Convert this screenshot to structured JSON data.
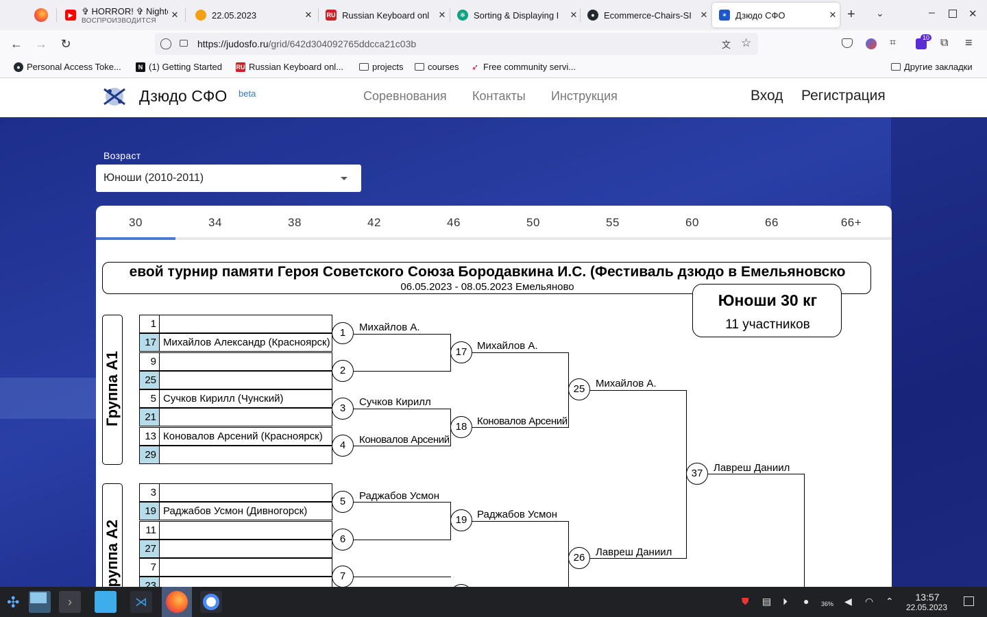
{
  "browser": {
    "tabs": [
      {
        "title": "✞ HORROR! ✞ Nightc",
        "subtitle": "ВОСПРОИЗВОДИТСЯ",
        "icon": "youtube-icon",
        "color": "#ff0000"
      },
      {
        "title": "22.05.2023",
        "icon": "loop-icon",
        "color": "#f4a015"
      },
      {
        "title": "Russian Keyboard onl",
        "icon": "ru-icon",
        "color": "#d01f25"
      },
      {
        "title": "Sorting & Displaying I",
        "icon": "openai-icon",
        "color": "#10a37f"
      },
      {
        "title": "Ecommerce-Chairs-SI",
        "icon": "github-icon",
        "color": "#24292f"
      },
      {
        "title": "Дзюдо СФО",
        "icon": "judo-icon",
        "color": "#1e57c8",
        "active": true
      }
    ],
    "url_host": "https://judosfo.ru",
    "url_path": "/grid/642d304092765ddcca21c03b",
    "extension_badge": "10",
    "bookmarks": [
      "Personal Access Toke...",
      "(1) Getting Started",
      "Russian Keyboard onl...",
      "projects",
      "courses",
      "Free community servi..."
    ],
    "other_bookmarks": "Другие закладки"
  },
  "site": {
    "brand": "Дзюдо СФО",
    "brand_tag": "beta",
    "menu": [
      "Соревнования",
      "Контакты",
      "Инструкция"
    ],
    "login": "Вход",
    "register": "Регистрация",
    "age_label": "Возраст",
    "age_value": "Юноши (2010-2011)",
    "weights": [
      "30",
      "34",
      "38",
      "42",
      "46",
      "50",
      "55",
      "60",
      "66",
      "66+"
    ],
    "active_weight": "30"
  },
  "bracket": {
    "title": "евой турнир памяти Героя Советского Союза Бородавкина И.С. (Фестиваль дзюдо в Емельяновско",
    "subtitle": "06.05.2023 - 08.05.2023 Емельяново",
    "category": "Юноши 30 кг",
    "participants": "11 участников",
    "group_a1": "Группа А1",
    "group_a2": "Группа А2",
    "slots": [
      {
        "n": "1",
        "name": ""
      },
      {
        "n": "17",
        "name": "Михайлов Александр (Красноярск)"
      },
      {
        "n": "9",
        "name": ""
      },
      {
        "n": "25",
        "name": ""
      },
      {
        "n": "5",
        "name": "Сучков Кирилл (Чунский)"
      },
      {
        "n": "21",
        "name": ""
      },
      {
        "n": "13",
        "name": "Коновалов Арсений (Красноярск)"
      },
      {
        "n": "29",
        "name": ""
      },
      {
        "n": "3",
        "name": ""
      },
      {
        "n": "19",
        "name": "Раджабов Усмон (Дивногорск)"
      },
      {
        "n": "11",
        "name": ""
      },
      {
        "n": "27",
        "name": ""
      },
      {
        "n": "7",
        "name": ""
      },
      {
        "n": "23",
        "name": ""
      }
    ],
    "bouts": [
      {
        "n": "1",
        "winner": "Михайлов А."
      },
      {
        "n": "2",
        "winner": ""
      },
      {
        "n": "3",
        "winner": "Сучков Кирилл"
      },
      {
        "n": "4",
        "winner": "Коновалов Арсений"
      },
      {
        "n": "17",
        "winner": "Михайлов А."
      },
      {
        "n": "18",
        "winner": "Коновалов Арсений"
      },
      {
        "n": "25",
        "winner": "Михайлов А."
      },
      {
        "n": "5",
        "winner": "Раджабов Усмон"
      },
      {
        "n": "6",
        "winner": ""
      },
      {
        "n": "19",
        "winner": "Раджабов Усмон"
      },
      {
        "n": "26",
        "winner": "Лавреш Даниил"
      },
      {
        "n": "37",
        "winner": "Лавреш Даниил"
      },
      {
        "n": "7",
        "winner": ""
      }
    ]
  },
  "taskbar": {
    "time": "13:57",
    "date": "22.05.2023",
    "battery": "36%"
  }
}
